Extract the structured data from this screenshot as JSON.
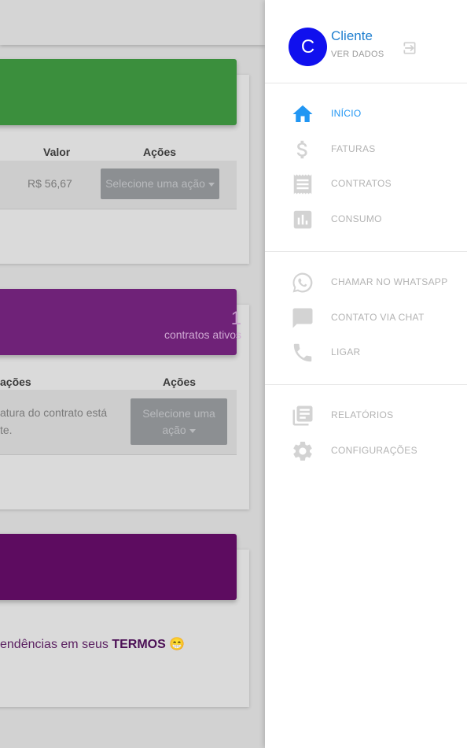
{
  "background": {
    "card1": {
      "headers": {
        "valor": "Valor",
        "acoes": "Ações"
      },
      "row": {
        "valor": "R$ 56,67",
        "action_label": "Selecione uma ação"
      }
    },
    "card2": {
      "count": "1",
      "count_label": "contratos ativos",
      "headers": {
        "col": "ações",
        "acoes": "Ações"
      },
      "row": {
        "text_line1": "atura do contrato está",
        "text_line2": "te.",
        "action_line1": "Selecione uma",
        "action_line2": "ação"
      }
    },
    "card3": {
      "text_prefix": "endências em seus ",
      "text_bold": "TERMOS",
      "emoji": "😁"
    }
  },
  "drawer": {
    "profile": {
      "avatar_letter": "C",
      "name": "Cliente",
      "subtitle": "VER DADOS"
    },
    "main_menu": [
      {
        "label": "INÍCIO",
        "icon": "home-icon",
        "active": true
      },
      {
        "label": "FATURAS",
        "icon": "dollar-icon",
        "active": false
      },
      {
        "label": "CONTRATOS",
        "icon": "receipt-icon",
        "active": false
      },
      {
        "label": "CONSUMO",
        "icon": "bar-chart-icon",
        "active": false
      }
    ],
    "contact_menu": [
      {
        "label": "CHAMAR NO WHATSAPP",
        "icon": "whatsapp-icon"
      },
      {
        "label": "CONTATO VIA CHAT",
        "icon": "chat-icon"
      },
      {
        "label": "LIGAR",
        "icon": "phone-icon"
      }
    ],
    "extra_menu": [
      {
        "label": "RELATÓRIOS",
        "icon": "reports-icon"
      },
      {
        "label": "CONFIGURAÇÕES",
        "icon": "gear-icon"
      }
    ]
  },
  "colors": {
    "active": "#2196f3",
    "avatar": "#1010ee",
    "icon_muted": "#d3d3d3"
  }
}
